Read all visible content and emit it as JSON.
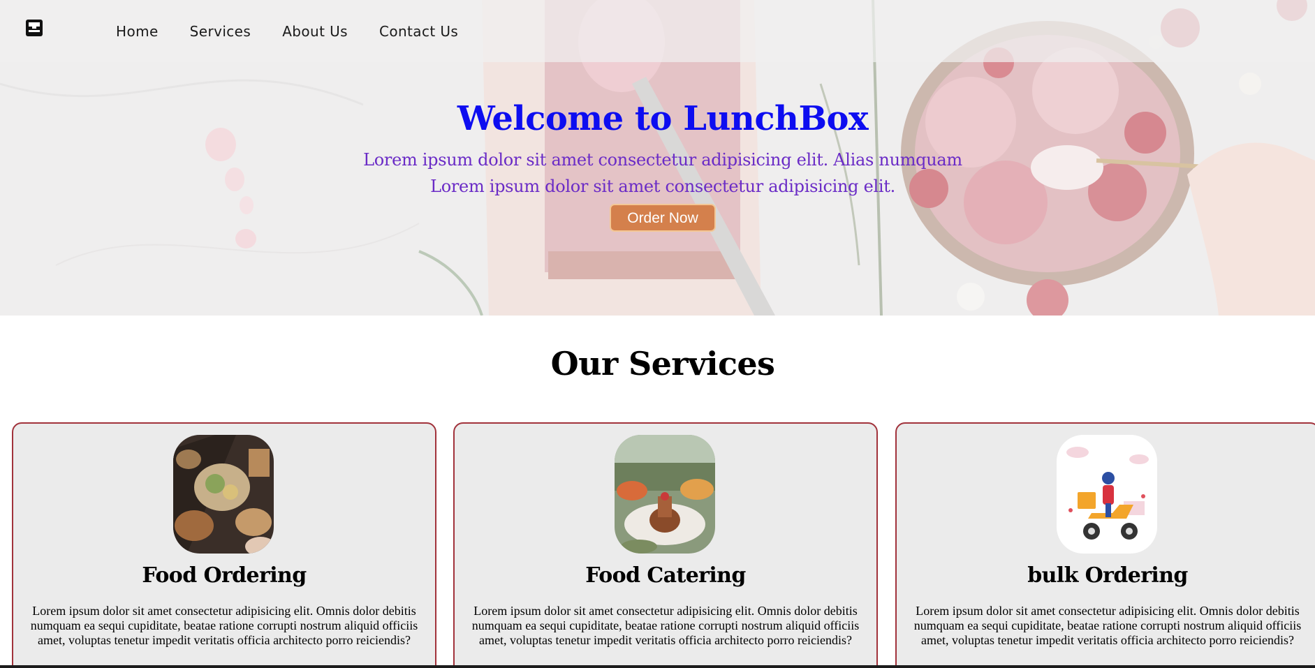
{
  "nav": {
    "logo_icon": "lunchbox-icon",
    "links": [
      "Home",
      "Services",
      "About Us",
      "Contact Us"
    ]
  },
  "hero": {
    "title": "Welcome to LunchBox",
    "subtitle_line1": "Lorem ipsum dolor sit amet consectetur adipisicing elit. Alias numquam",
    "subtitle_line2": "Lorem ipsum dolor sit amet consectetur adipisicing elit.",
    "order_label": "Order Now"
  },
  "services": {
    "heading": "Our Services",
    "cards": [
      {
        "title": "Food Ordering",
        "text": "Lorem ipsum dolor sit amet consectetur adipisicing elit. Omnis dolor debitis numquam ea sequi cupiditate, beatae ratione corrupti nostrum aliquid officiis amet, voluptas tenetur impedit veritatis officia architecto porro reiciendis?"
      },
      {
        "title": "Food Catering",
        "text": "Lorem ipsum dolor sit amet consectetur adipisicing elit. Omnis dolor debitis numquam ea sequi cupiditate, beatae ratione corrupti nostrum aliquid officiis amet, voluptas tenetur impedit veritatis officia architecto porro reiciendis?"
      },
      {
        "title": "bulk Ordering",
        "text": "Lorem ipsum dolor sit amet consectetur adipisicing elit. Omnis dolor debitis numquam ea sequi cupiditate, beatae ratione corrupti nostrum aliquid officiis amet, voluptas tenetur impedit veritatis officia architecto porro reiciendis?"
      }
    ]
  },
  "colors": {
    "title_blue": "#0d0df0",
    "subtitle_purple": "#6a2bc6",
    "button_orange": "#d4804c",
    "card_border": "#a1323b",
    "card_bg": "#ebebeb"
  }
}
